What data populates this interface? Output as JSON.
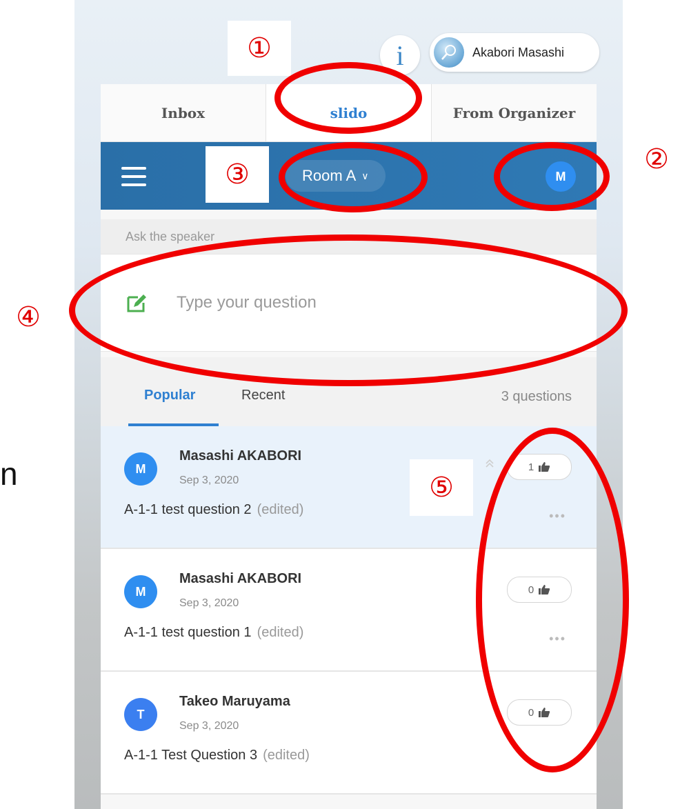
{
  "side_letter": "n",
  "top": {
    "info_label": "i",
    "user_name": "Akabori Masashi"
  },
  "tabs": [
    {
      "label": "Inbox"
    },
    {
      "label": "slido"
    },
    {
      "label": "From Organizer"
    }
  ],
  "appbar": {
    "room_label": "Room A",
    "room_chevron": "∨",
    "avatar_initial": "M"
  },
  "ask": {
    "label": "Ask the speaker",
    "placeholder": "Type your question"
  },
  "filters": {
    "popular": "Popular",
    "recent": "Recent",
    "count": "3 questions"
  },
  "questions": [
    {
      "initial": "M",
      "author": "Masashi AKABORI",
      "date": "Sep 3, 2020",
      "text": "A-1-1 test question 2",
      "edited": "(edited)",
      "likes": "1",
      "more": "•••"
    },
    {
      "initial": "M",
      "author": "Masashi AKABORI",
      "date": "Sep 3, 2020",
      "text": "A-1-1 test question 1",
      "edited": "(edited)",
      "likes": "0",
      "more": "•••"
    },
    {
      "initial": "T",
      "author": "Takeo Maruyama",
      "date": "Sep 3, 2020",
      "text": "A-1-1 Test Question 3",
      "edited": "(edited)",
      "likes": "0"
    }
  ],
  "markers": {
    "m1": "①",
    "m2": "②",
    "m3": "③",
    "m4": "④",
    "m5": "⑤"
  },
  "colors": {
    "accent": "#2f80d1",
    "appbar": "#2a6fa8",
    "annotation_red": "#f00000"
  }
}
